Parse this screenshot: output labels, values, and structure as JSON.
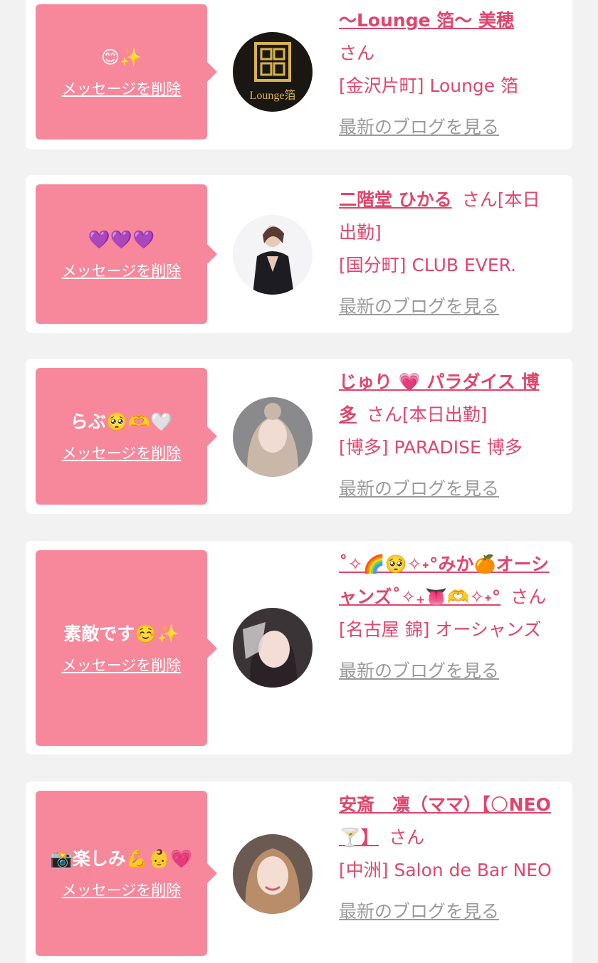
{
  "theme": {
    "bubble_color": "#f7889c",
    "name_color": "#e0456c",
    "link_gray": "#9a9a9a",
    "page_bg": "#f2f2f2"
  },
  "cards": [
    {
      "message": "😊✨",
      "delete_label": "メッセージを削除",
      "name": "〜Lounge 箔〜 美穂",
      "san": "さん",
      "work_status": "",
      "shop": "[金沢片町] Lounge 箔",
      "blog_link": "最新のブログを見る",
      "avatar_text": "Lounge箔"
    },
    {
      "message": "💜💜💜",
      "delete_label": "メッセージを削除",
      "name": "二階堂 ひかる",
      "san": "さん",
      "work_status": "[本日出勤]",
      "shop": "[国分町] CLUB EVER.",
      "blog_link": "最新のブログを見る",
      "avatar_text": ""
    },
    {
      "message": "らぶ🥺🫶🤍",
      "delete_label": "メッセージを削除",
      "name": "じゅり 💗 パラダイス 博多",
      "san": "さん",
      "work_status": "[本日出勤]",
      "shop": "[博多] PARADISE 博多",
      "blog_link": "最新のブログを見る",
      "avatar_text": ""
    },
    {
      "message": "素敵です☺️✨",
      "delete_label": "メッセージを削除",
      "name": "˚✧🌈🥺✧˖°みか🍊オーシャンズ˚✧₊👅🫶✧˖°",
      "san": "さん",
      "work_status": "",
      "shop": "[名古屋 錦] オーシャンズ",
      "blog_link": "最新のブログを見る",
      "avatar_text": ""
    },
    {
      "message": "📸楽しみ💪👶💗",
      "delete_label": "メッセージを削除",
      "name": "安斎　凛（ママ）【🌕NEO🍸】",
      "san": "さん",
      "work_status": "",
      "shop": "[中洲] Salon de Bar NEO",
      "blog_link": "最新のブログを見る",
      "avatar_text": ""
    }
  ]
}
